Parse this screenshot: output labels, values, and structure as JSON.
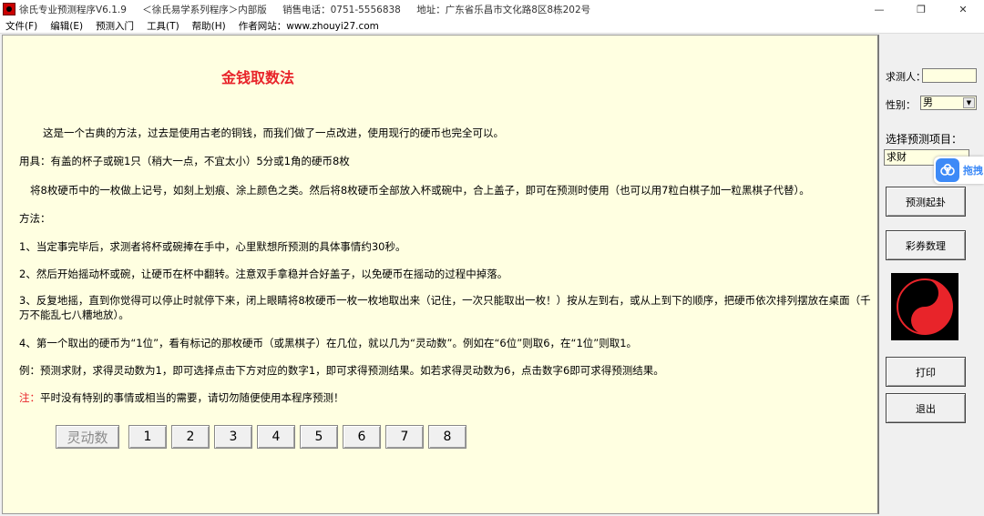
{
  "window": {
    "app_title": "徐氏专业预测程序V6.1.9",
    "series": "＜徐氏易学系列程序＞内部版",
    "sales_phone": "销售电话：0751-5556838",
    "address": "地址：广东省乐昌市文化路8区8栋202号",
    "minimize": "—",
    "restore": "❐",
    "close": "✕"
  },
  "menu": [
    "文件(F)",
    "编辑(E)",
    "预测入门",
    "工具(T)",
    "帮助(H)",
    "作者网站：www.zhouyi27.com"
  ],
  "content": {
    "title": "金钱取数法",
    "paragraphs": {
      "intro": "这是一个古典的方法，过去是使用古老的铜钱，而我们做了一点改进，使用现行的硬币也完全可以。",
      "tools": "用具：有盖的杯子或碗1只（稍大一点，不宜太小）5分或1角的硬币8枚",
      "prep": "将8枚硬币中的一枚做上记号，如刻上划痕、涂上颜色之类。然后将8枚硬币全部放入杯或碗中，合上盖子，即可在预测时使用（也可以用7粒白棋子加一粒黑棋子代替）。",
      "method": "方法：",
      "step1": "1、当定事完毕后，求测者将杯或碗捧在手中，心里默想所预测的具体事情约30秒。",
      "step2": "2、然后开始摇动杯或碗，让硬币在杯中翻转。注意双手拿稳并合好盖子，以免硬币在摇动的过程中掉落。",
      "step3": "3、反复地摇，直到你觉得可以停止时就停下来，闭上眼睛将8枚硬币一枚一枚地取出来（记住，一次只能取出一枚！）按从左到右，或从上到下的顺序，把硬币依次排列摆放在桌面（千万不能乱七八糟地放）。",
      "step4": "4、第一个取出的硬币为“1位”，看有标记的那枚硬币（或黑棋子）在几位，就以几为“灵动数”。例如在“6位”则取6，在“1位”则取1。",
      "example": "例：预测求财，求得灵动数为1，即可选择点击下方对应的数字1，即可求得预测结果。如若求得灵动数为6，点击数字6即可求得预测结果。",
      "note_label": "注：",
      "note": "平时没有特别的事情或相当的需要，请切勿随便使用本程序预测！"
    },
    "number_label": "灵动数",
    "numbers": [
      "1",
      "2",
      "3",
      "4",
      "5",
      "6",
      "7",
      "8"
    ]
  },
  "side": {
    "person_label": "求测人：",
    "person_value": "",
    "gender_label": "性别：",
    "gender_value": "男",
    "project_label": "选择预测项目：",
    "project_value": "求财",
    "btn_start": "预测起卦",
    "btn_lottery": "彩券数理",
    "btn_print": "打印",
    "btn_exit": "退出"
  },
  "float_widget": {
    "text": "拖拽",
    "icon": "cloud-icon",
    "color": "#3d8af7"
  },
  "colors": {
    "panel_bg": "#ffffe1",
    "title_red": "#e8242a"
  }
}
